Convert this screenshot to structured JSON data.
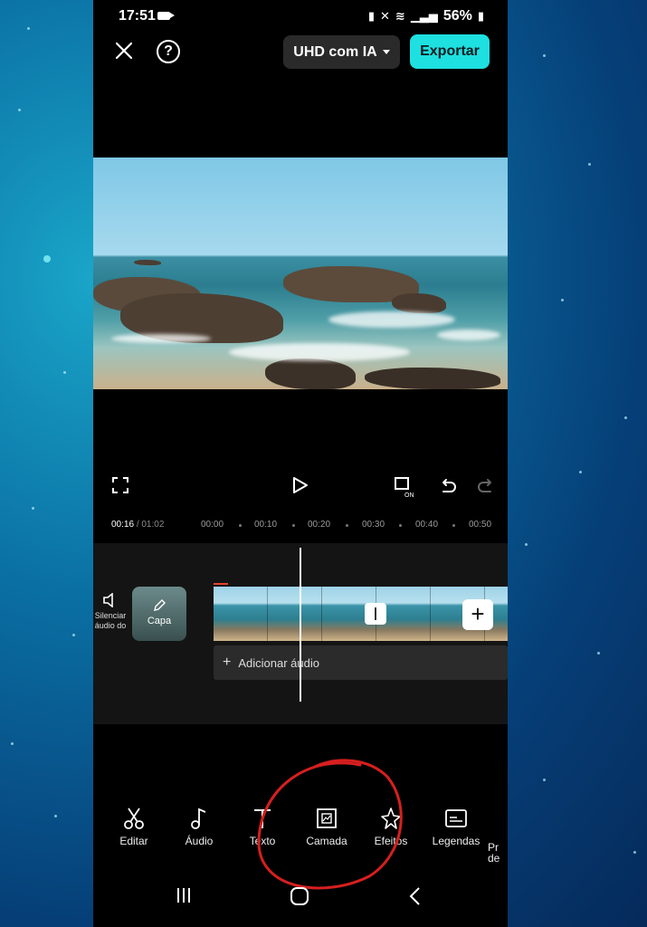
{
  "status_bar": {
    "time": "17:51",
    "battery": "56%"
  },
  "header": {
    "quality": "UHD com IA",
    "export": "Exportar"
  },
  "ruler": {
    "current": "00:16",
    "total": "/ 01:02",
    "ticks": [
      "00:00",
      "00:10",
      "00:20",
      "00:30",
      "00:40",
      "00:50"
    ]
  },
  "timeline": {
    "mute_label": "Silenciar\náudio do",
    "cover_label": "Capa",
    "add_audio": "Adicionar áudio"
  },
  "toolbar": {
    "items": [
      {
        "label": "Editar",
        "icon": "scissors-icon"
      },
      {
        "label": "Áudio",
        "icon": "music-note-icon"
      },
      {
        "label": "Texto",
        "icon": "text-icon"
      },
      {
        "label": "Camada",
        "icon": "layer-icon"
      },
      {
        "label": "Efeitos",
        "icon": "effects-star-icon"
      },
      {
        "label": "Legendas",
        "icon": "captions-icon"
      },
      {
        "label": "Pr\nde",
        "icon": "partial-tool-icon"
      }
    ]
  },
  "colors": {
    "accent": "#1ee0e0",
    "annotation": "#d61f1f"
  }
}
